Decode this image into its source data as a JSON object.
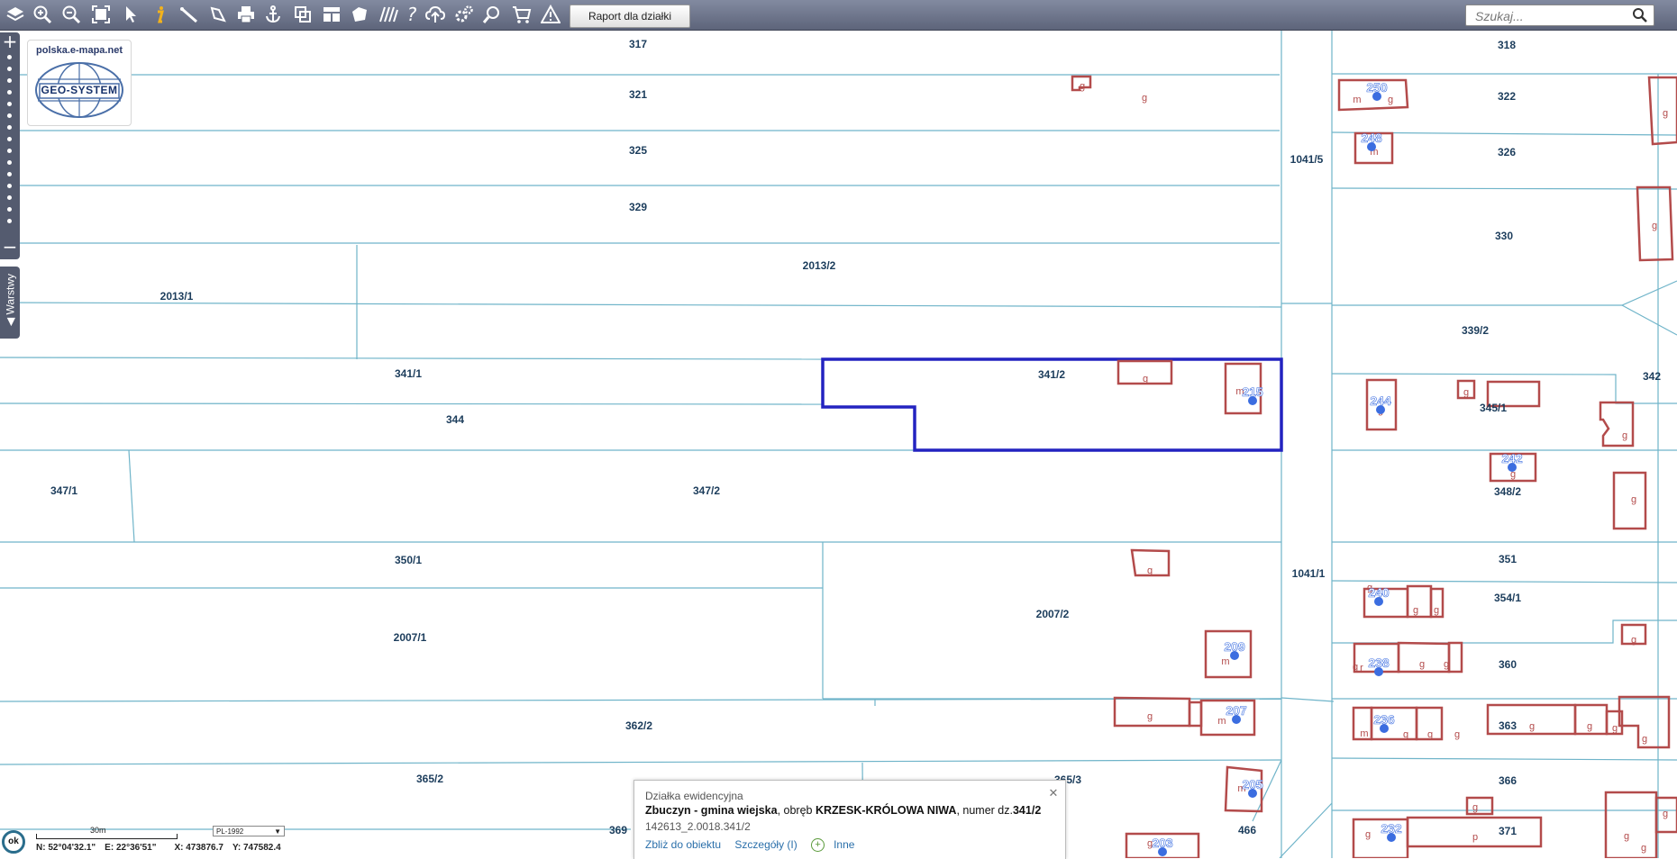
{
  "toolbar": {
    "tools": [
      "layers-icon",
      "zoom-in-icon",
      "zoom-out-icon",
      "zoom-extent-icon",
      "pointer-icon",
      "info-icon",
      "measure-distance-icon",
      "measure-area-icon",
      "print-icon",
      "anchor-icon",
      "copy-icon",
      "layout-icon",
      "shape-icon",
      "hatch-icon",
      "help-icon",
      "cloud-upload-icon",
      "settings-icon",
      "search-zoom-icon",
      "cart-icon",
      "warning-icon"
    ],
    "report_button_label": "Raport dla działki",
    "search_placeholder": "Szukaj..."
  },
  "side_panel": {
    "zoom_in": "+",
    "zoom_out": "−",
    "layers_label": "Warstwy"
  },
  "logo": {
    "url_text": "polska.e-mapa.net",
    "brand_text": "GEO-SYSTEM"
  },
  "map": {
    "colors": {
      "parcel_line": "#6fb4c9",
      "building": "#b34b4b",
      "selected": "#2323c0",
      "label": "#1c3d5c",
      "address_dot": "#3b6de0"
    },
    "parcel_labels": [
      {
        "id": "317",
        "text": "317"
      },
      {
        "id": "321",
        "text": "321"
      },
      {
        "id": "325",
        "text": "325"
      },
      {
        "id": "329",
        "text": "329"
      },
      {
        "id": "2013-1",
        "text": "2013/1"
      },
      {
        "id": "2013-2",
        "text": "2013/2"
      },
      {
        "id": "341-1",
        "text": "341/1"
      },
      {
        "id": "341-2",
        "text": "341/2"
      },
      {
        "id": "344",
        "text": "344"
      },
      {
        "id": "347-1",
        "text": "347/1"
      },
      {
        "id": "347-2",
        "text": "347/2"
      },
      {
        "id": "350-1",
        "text": "350/1"
      },
      {
        "id": "2007-1",
        "text": "2007/1"
      },
      {
        "id": "2007-2",
        "text": "2007/2"
      },
      {
        "id": "362-2",
        "text": "362/2"
      },
      {
        "id": "365-2",
        "text": "365/2"
      },
      {
        "id": "365-3",
        "text": "365/3"
      },
      {
        "id": "369",
        "text": "369"
      },
      {
        "id": "466",
        "text": "466"
      },
      {
        "id": "1041-5",
        "text": "1041/5"
      },
      {
        "id": "1041-1",
        "text": "1041/1"
      },
      {
        "id": "318",
        "text": "318"
      },
      {
        "id": "322",
        "text": "322"
      },
      {
        "id": "326",
        "text": "326"
      },
      {
        "id": "330",
        "text": "330"
      },
      {
        "id": "339-2",
        "text": "339/2"
      },
      {
        "id": "342",
        "text": "342"
      },
      {
        "id": "345-1",
        "text": "345/1"
      },
      {
        "id": "348-2",
        "text": "348/2"
      },
      {
        "id": "351",
        "text": "351"
      },
      {
        "id": "354-1",
        "text": "354/1"
      },
      {
        "id": "360",
        "text": "360"
      },
      {
        "id": "363",
        "text": "363"
      },
      {
        "id": "366",
        "text": "366"
      },
      {
        "id": "371",
        "text": "371"
      }
    ],
    "address_numbers": [
      "250",
      "248",
      "215",
      "244",
      "242",
      "240",
      "238",
      "236",
      "209",
      "207",
      "205",
      "203",
      "232"
    ],
    "building_codes": [
      "g",
      "m",
      "p",
      "r"
    ]
  },
  "scale": {
    "label": "30m",
    "crs": "PL-1992"
  },
  "coordinates": {
    "lat": "N: 52°04'32.1\"",
    "lon": "E: 22°36'51\"",
    "x": "X: 473876.7",
    "y": "Y: 747582.4"
  },
  "ok_label": "ok",
  "popup": {
    "title": "Działka ewidencyjna",
    "municipality": "Zbuczyn - gmina wiejska",
    "obreb_prefix": ", obręb ",
    "obreb": "KRZESK-KRÓLOWA NIWA",
    "number_prefix": ", numer dz.",
    "number": "341/2",
    "teryt_id": "142613_2.0018.341/2",
    "links": {
      "zoom": "Zbliż do obiektu",
      "details": "Szczegóły (I)",
      "other": "Inne"
    }
  }
}
